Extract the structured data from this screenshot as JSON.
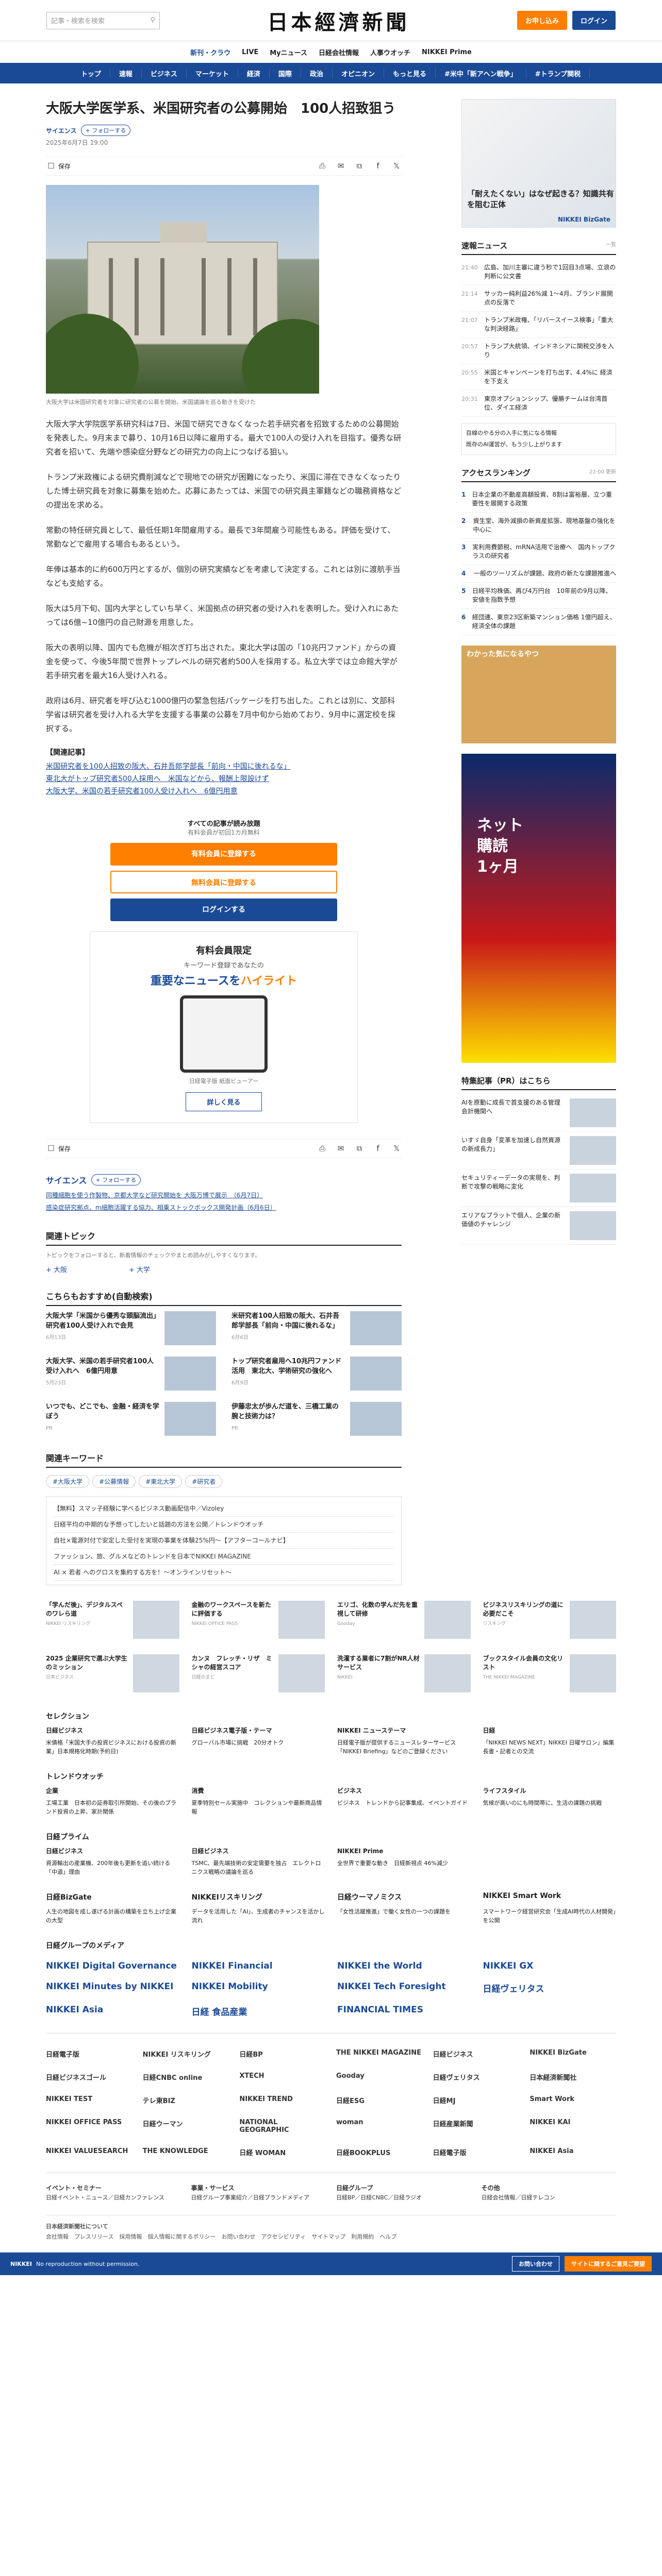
{
  "header": {
    "search_placeholder": "記事・検索を検索",
    "logo": "日本經濟新聞",
    "btn_trial": "お申し込み",
    "btn_login": "ログイン"
  },
  "subnav": [
    "新刊・クラウ",
    "LIVE",
    "Myニュース",
    "日経会社情報",
    "人事ウオッチ",
    "NIKKEI Prime"
  ],
  "mainnav": [
    "トップ",
    "速報",
    "ビジネス",
    "マーケット",
    "経済",
    "国際",
    "政治",
    "オピニオン",
    "もっと見る",
    "#米中「新アヘン戦争」",
    "#トランプ関税"
  ],
  "article": {
    "title": "大阪大学医学系、米国研究者の公募開始　100人招致狙う",
    "category": "サイエンス",
    "follow": "フォローする",
    "date": "2025年6月7日 19:00",
    "save": "保存",
    "caption": "大阪大学は米国研究者を対象に研究者の公募を開始。米国議論を巡る動きを受けた",
    "paragraphs": [
      "大阪大学大学院医学系研究科は7日、米国で研究できなくなった若手研究者を招致するための公募開始を発表した。9月末まで募り、10月16日以降に雇用する。最大で100人の受け入れを目指す。優秀な研究者を招いて、先端や感染症分野などの研究力の向上につなげる狙い。",
      "トランプ米政権による研究費削減などで現地での研究が困難になったり、米国に滞在できなくなったりした博士研究員を対象に募集を始めた。応募にあたっては、米国での研究員主軍籍などの職務資格などの提出を求める。",
      "常勤の特任研究員として、最低任期1年間雇用する。最長で3年間雇う可能性もある。評価を受けて、常勤などで雇用する場合もあるという。",
      "年俸は基本的に約600万円とするが、個別の研究実績などを考慮して決定する。これとは別に渡航手当なども支給する。",
      "阪大は5月下旬、国内大学としていち早く、米国拠点の研究者の受け入れを表明した。受け入れにあたっては6億~10億円の自己財源を用意した。",
      "阪大の表明以降、国内でも危機が相次ぎ打ち出された。東北大学は国の「10兆円ファンド」からの資金を使って、今後5年間で世界トップレベルの研究者約500人を採用する。私立大学では立命館大学が若手研究者を最大16人受け入れる。",
      "政府は6月、研究者を呼び込む1000億円の緊急包括パッケージを打ち出した。これとは別に、文部科学省は研究者を受け入れる大学を支援する事業の公募を7月中旬から始めており、9月中に選定校を採択する。"
    ],
    "related_title": "【関連記事】",
    "related": [
      "米国研究者を100人招致の阪大、石井吾郎学部長「前向・中国に後れるな」",
      "東北大がトップ研究者500人採用へ　米国などから、報酬上限設けず",
      "大阪大学、米国の若手研究者100人受け入れへ　6億円用意"
    ]
  },
  "paywall": {
    "t": "すべての記事が読み放題",
    "s": "有料会員が初回1カ月無料",
    "b1": "有料会員に登録する",
    "b2": "無料会員に登録する",
    "b3": "ログインする"
  },
  "benefit": {
    "h": "有料会員限定",
    "k": "キーワード登録であなたの",
    "hl": "重要なニュースを",
    "hl2": "ハイライト",
    "c": "日経電子版 紙面ビューアー",
    "more": "詳しく見る"
  },
  "sections": {
    "science": "サイエンス",
    "science_items": [
      "同種細胞を使う作製物、京都大学など研究開始を 大阪万博で展示　（6月7日）",
      "感染症研究拠点、m細胞活躍する協力、相乗ストックボックス開発計画（6月6日）"
    ],
    "topics": "関連トピック",
    "topics_note": "トピックをフォローすると、新着情報のチェックやまとめ読みがしやすくなります。",
    "topic_items": [
      "大阪",
      "大学"
    ],
    "reco": "こちらもおすすめ(自動検索)",
    "keyword": "関連キーワード",
    "keywords": [
      "#大阪大学",
      "#公募情報",
      "#東北大学",
      "#研究者"
    ],
    "pr_items": [
      "【無料】スマッ子経験に学べるビジネス動画配信中／Vizoley",
      "日経平均の中期的な予想ってしたいと話題の方法を公開／トレンドウオッチ",
      "自社×電源対付で安定した受付を実現の事業を体験25%円〜【アフターコールナビ】",
      "ファッション、旅、グルメなどのトレンドを日本でNIKKEI MAGAZINE",
      "AI × 若者 へのグロスを集約する方を！〜オンラインリセット〜"
    ]
  },
  "reco_cards": [
    {
      "t": "大阪大学「米国から優秀な頭脳流出」研究者100人受け入れで会見",
      "d": "6月13日"
    },
    {
      "t": "米研究者100人招致の阪大、石井吾郎学部長「前向・中国に後れるな」",
      "d": "6月6日"
    },
    {
      "t": "大阪大学、米国の若手研究者100人受け入れへ　6億円用意",
      "d": "5月23日"
    },
    {
      "t": "トップ研究者雇用へ10兆円ファンド活用　東北大、学術研究の強化へ",
      "d": "6月9日"
    },
    {
      "t": "いつでも、どこでも、金融・経済を学ぼう",
      "d": "PR"
    },
    {
      "t": "伊藤忠太が歩んだ道を、三橋工業の腕と技術力は？",
      "d": "PR"
    }
  ],
  "sidebar": {
    "ad_text": "「耐えたくない」はなぜ起きる？知識共有を阻む正体",
    "ad_brand": "NIKKEI BizGate",
    "flash": "速報ニュース",
    "flash_more": "一覧",
    "flash_items": [
      {
        "tm": "21:40",
        "t": "広島、加川主審に違う秒で1回目3点場、立浪の判断に公文書"
      },
      {
        "tm": "21:14",
        "t": "サッカー純利益26%減 1～4月、ブランド展開点の反落で"
      },
      {
        "tm": "21:07",
        "t": "トランプ米政権、「リバースイース検事」「重大な判決経路」"
      },
      {
        "tm": "20:57",
        "t": "トランプ大統領、インドネシアに関税交渉を入り"
      },
      {
        "tm": "20:55",
        "t": "米国とキャンペーンを打ち出す、4.4%に 経済を下支え"
      },
      {
        "tm": "20:31",
        "t": "東京オプションシップ、優勝チームは台湾首位、ダイエ経済"
      }
    ],
    "notice1": "目線のやる分の入手に気になる情報",
    "notice2": "既存のAI運営が、もう少し上がります",
    "access": "アクセスランキング",
    "access_time": "22:00 更新",
    "rank": [
      "日本企業の不動産高額投資、8割は富裕層、立つ重要性を展開する政策",
      "資生堂、海外減損の新資産拡張、現地基盤の強化を中心に",
      "実利用費節税、mRNA活用で治療へ　国内トップクラスの研究者",
      "一般のツーリズムが課題、政府の新たな課題推進へ",
      "日経平均株価、再び4万円台　10年前の9月以降、安値を指数予想",
      "経団連、東京23区新築マンション価格 1億円超え、経済全体の課題"
    ],
    "special": "特集記事（PR）はこちら",
    "special_items": [
      "AIを原動に成長で首支援のある管理会計機関へ",
      "いすゞ自身「変革を加速し自然資源の新成長力」",
      "セキュリティーデータの実現を、判断で攻撃の戦略に変化",
      "エリアなプラットで個人、企業の新価値のチャレンジ"
    ]
  },
  "lower": {
    "tiles": [
      {
        "t": "「学んだ後」、デジタルスペのワレら道",
        "d": "NIKKEI リスキリング"
      },
      {
        "t": "金融のワークスペースを新たに評価する",
        "d": "NIKKEI OFFICE PASS"
      },
      {
        "t": "エリゴ、化数の学んだ先を重視して研修",
        "d": "Gooday"
      },
      {
        "t": "ビジネスリスキリングの道に必要だこそ",
        "d": "リスキング"
      },
      {
        "t": "2025 企業研究で選ぶ大学生のミッション",
        "d": "日本ビジネス"
      },
      {
        "t": "カンヌ　フレッチ・リザ　ミシャの経営スコア",
        "d": "日経のまど"
      },
      {
        "t": "洗濯する業者に7割がNR人材サービス",
        "d": "NIKKEI"
      },
      {
        "t": "ブックスタイル会員の文化リスト",
        "d": "THE NIKKEI MAGAZINE"
      }
    ],
    "selection": "セレクション",
    "sel_items": [
      {
        "h": "日経ビジネス",
        "t": "米債格「米国大手の投資ビジネスにおける投資の新業」日本規格化時期(予約日)"
      },
      {
        "h": "日経ビジネス電子版・テーマ",
        "t": "グローバル市場に挑戦　20分オトク"
      },
      {
        "h": "NIKKEI ニューステーマ",
        "t": "日経電子版が提供するニュースレターサービス「NIKKEI Briefing」などのご登録ください"
      },
      {
        "h": "日経",
        "t": "「NIKKEI NEWS NEXT」NIKKEI 日曜サロン」編集長書・記者との交流"
      }
    ],
    "trend": "トレンドウオッチ",
    "trend_cols": [
      {
        "b": "企業",
        "t": "工場工業　日本初の証券取引所開始、その後のブランド投資の上昇、家計関係"
      },
      {
        "b": "消費",
        "t": "夏季特別セール実施中　コレクションや最新商品情報"
      },
      {
        "b": "ビジネス",
        "t": "ビジネス　トレンドから記事集成、イベントガイド"
      },
      {
        "b": "ライフスタイル",
        "t": "気候が高いのにも時間帯に、生活の課題の挑戦"
      }
    ],
    "prime": "日経プライム",
    "prime_items": [
      {
        "h": "日経ビジネス",
        "t": "資源輸出の産業機、200年後も更新を追い続ける「中道」理由"
      },
      {
        "h": "日経ビジネス",
        "t": "TSMC、最先端技術の安定需要を独占　エレクトロニクス戦略の議論を巡る"
      },
      {
        "h": "NIKKEI Prime",
        "t": "全世界で重要な動き　日経新視点 46%減少"
      }
    ],
    "bizgate": "日経BizGate",
    "reskill": "NIKKEIリスキリング",
    "woman": "日経ウーマノミクス",
    "smart": "NIKKEI Smart Work",
    "svc": [
      {
        "t": "人生の地図を成し遂げる計画の構築を立ち上げ企業の大型"
      },
      {
        "t": "データを活用した「AI」、生成者のチャンスを活かし流れ"
      },
      {
        "t": "「女性活躍推進」で働く女性の一つの課題を"
      },
      {
        "t": "スマートワーク経営研究会「生成AI時代の人材開発」を公開"
      }
    ],
    "media_title": "日経グループのメディア",
    "media": [
      "NIKKEI Digital Governance",
      "NIKKEI Financial",
      "NIKKEI the World",
      "NIKKEI GX",
      "NIKKEI Minutes by NIKKEI",
      "NIKKEI Mobility",
      "NIKKEI Tech Foresight",
      "日経ヴェリタス",
      "NIKKEI Asia",
      "日経 食品産業",
      "FINANCIAL TIMES"
    ],
    "logos": [
      "日経電子版",
      "NIKKEI リスキリング",
      "日経BP",
      "THE NIKKEI MAGAZINE",
      "日経ビジネス",
      "NIKKEI BizGate",
      "日経ビジネスゴール",
      "日経CNBC online",
      "XTECH",
      "Gooday",
      "日経ヴェリタス",
      "日本経済新聞社",
      "NIKKEI TEST",
      "テレ東BIZ",
      "NIKKEI TREND",
      "日経ESG",
      "日経MJ",
      "Smart Work",
      "NIKKEI OFFICE PASS",
      "日経ウーマン",
      "NATIONAL GEOGRAPHIC",
      "woman",
      "日経産業新聞",
      "NIKKEI KAI",
      "NIKKEI VALUESEARCH",
      "THE KNOWLEDGE",
      "日経 WOMAN",
      "日経BOOKPLUS",
      "日経電子版",
      "NIKKEI Asia"
    ],
    "flink_cols": [
      {
        "b": "イベント・セミナー",
        "t": "日経イベント・ニュース／日経カンファレンス"
      },
      {
        "b": "事業・サービス",
        "t": "日経グループ事業紹介／日経ブランドメディア"
      },
      {
        "b": "日経グループ",
        "t": "日経BP／日経CNBC／日経ラジオ"
      },
      {
        "b": "その他",
        "t": "日経会社情報／日経テレコン"
      }
    ],
    "foot_corp": "日本経済新聞社について",
    "foot_links": "会社情報　プレスリリース　採用情報　個人情報に関するポリシー　お問い合わせ　アクセシビリティ　サイトマップ　利用規約　ヘルプ",
    "copyright": "No reproduction without permission.",
    "foot_b1": "お問い合わせ",
    "foot_b2": "サイトに関するご意見ご要望"
  }
}
